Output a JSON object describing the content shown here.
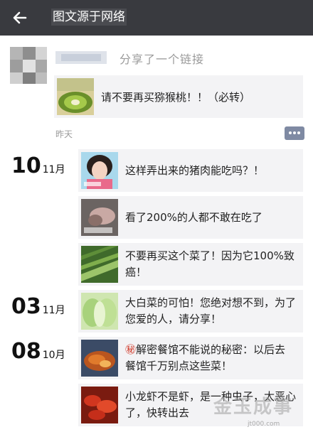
{
  "header": {
    "title": "图文源于网络"
  },
  "share": {
    "action_text": "分享了一个链接",
    "link_title": "请不要再买猕猴桃！！（必转）",
    "time": "昨天"
  },
  "posts": [
    {
      "day": "10",
      "month": "11月",
      "text": "这样弄出来的猪肉能吃吗？！",
      "thumb": "woman-photo"
    },
    {
      "text": "看了200%的人都不敢在吃了",
      "thumb": "meat-photo"
    },
    {
      "text": "不要再买这个菜了！因为它100%致癌！",
      "thumb": "vegetable-photo"
    },
    {
      "day": "03",
      "month": "11月",
      "text": "大白菜的可怕！您绝对想不到，为了您爱的人，请分享！",
      "thumb": "cabbage-photo"
    },
    {
      "day": "08",
      "month": "10月",
      "badge": "㊙",
      "text": "解密餐馆不能说的秘密：以后去餐馆千万别点这些菜！",
      "thumb": "dish-photo"
    },
    {
      "text": "小龙虾不是虾，是一种虫子，太恶心了，快转出去",
      "thumb": "crayfish-photo"
    }
  ],
  "watermark": {
    "text": "金玉成事",
    "url": "jt000.com"
  },
  "colors": {
    "topbar": "#393a3f",
    "card": "#f3f3f5",
    "comment_button": "#7f8aa3"
  }
}
